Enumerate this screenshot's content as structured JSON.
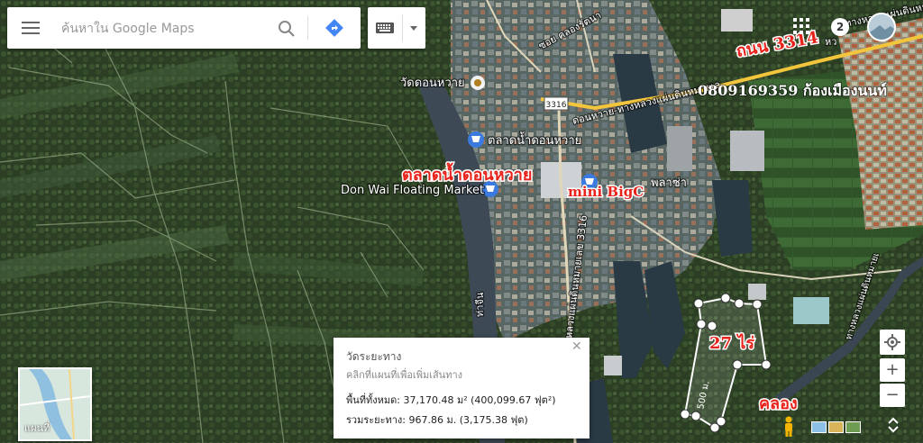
{
  "search": {
    "placeholder": "ค้นหาใน Google Maps"
  },
  "icons": {
    "menu": "hamburger-menu-icon",
    "search": "search-icon",
    "directions": "directions-icon",
    "keyboard": "keyboard-icon",
    "dropdown": "chevron-down-icon",
    "apps": "apps-grid-icon",
    "pegman": "pegman-icon",
    "expand": "expand-icon",
    "locate": "my-location-icon"
  },
  "colors": {
    "annotation_red": "#e8231b",
    "annotation_white": "#ffffff",
    "label_white": "#ffffff",
    "road_yellow": "#f2c53d",
    "poi_blue": "#3b7be0",
    "route_white": "#ffffff"
  },
  "header": {
    "notifications": "2"
  },
  "map_labels": {
    "temple": "วัดดอนหวาย",
    "market_th": "ตลาดน้ำดอนหวาย",
    "market_en": "Don Wai Floating Market",
    "plaza": "พลาซ่า",
    "soi": "ซอย คลองรัตนา",
    "road_long": "ดอนหวาย-ทางหลวงแผ่นดินหมายเล",
    "road_side": "หว",
    "road_right": "ทางหลวงแผ่นดินหมายเ",
    "road_vertical": "ทางหลวงแผ่นดินหมายเลข 3316",
    "route_badge": "3316",
    "pier": "ท่าจีน"
  },
  "annotations": {
    "road_label": "ถนน 3314",
    "phone": "0809169359 ก้องเมืองนนท์",
    "market_label": "ตลาดน้ำดอนหวาย",
    "bigc": "mini BigC",
    "area": "27 ไร่",
    "canal": "คลอง",
    "distance": "500 ม."
  },
  "info_box": {
    "title": "วัดระยะทาง",
    "hint": "คลิกที่แผนที่เพื่อเพิ่มเส้นทาง",
    "area": "พื้นที่ทั้งหมด: 37,170.48 ม² (400,099.67 ฟุต²)",
    "distance": "รวมระยะทาง: 967.86 ม. (3,175.38 ฟุต)"
  },
  "minimap": {
    "label": "แผนที่"
  },
  "controls": {
    "zoom_in": "+",
    "zoom_out": "−"
  }
}
